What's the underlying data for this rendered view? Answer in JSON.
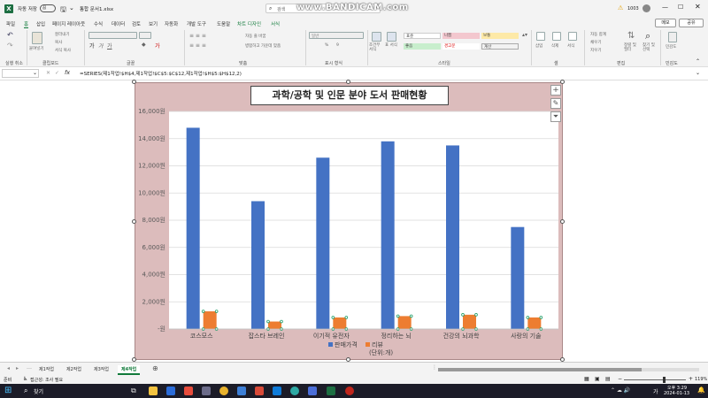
{
  "titlebar": {
    "autosave_label": "자동 저장",
    "autosave_state": "끔",
    "filename": "통합 문서1.xlsx",
    "search_label": "검색",
    "watermark": "www.BANDICAM.com",
    "user_code": "1003",
    "warning_icon": "warning-icon"
  },
  "tabs": [
    "파일",
    "홈",
    "삽입",
    "페이지 레이아웃",
    "수식",
    "데이터",
    "검토",
    "보기",
    "자동화",
    "개발 도구",
    "도움말",
    "차트 디자인",
    "서식"
  ],
  "active_tab": "홈",
  "tab_actions": {
    "memo": "메모",
    "share": "공유"
  },
  "ribbon": {
    "groups": [
      "실행 취소",
      "클립보드",
      "글꼴",
      "맞춤",
      "표시 형식",
      "스타일",
      "셀",
      "편집",
      "민감도"
    ],
    "clipboard": {
      "paste": "붙여넣기",
      "cut": "잘라내기",
      "copy": "복사",
      "format_painter": "서식 복사"
    },
    "alignment": {
      "wrap": "자동 줄 바꿈",
      "merge": "병합하고 가운데 맞춤"
    },
    "number": {
      "format": "일반",
      "percent": "%",
      "comma": "9"
    },
    "styles": {
      "conditional": "조건부 서식",
      "table": "표 서식",
      "cells": [
        "표준",
        "나쁨",
        "보통",
        "좋음",
        "경고문",
        "계산"
      ]
    },
    "cells": [
      "삽입",
      "삭제",
      "서식"
    ],
    "editing": {
      "autosum": "자동 합계",
      "fill": "채우기",
      "clear": "지우기",
      "sort": "정렬 및 필터",
      "find": "찾기 및 선택"
    },
    "sensitivity": "민감도"
  },
  "formula": {
    "name_box": "",
    "fx": "fx",
    "text": "=SERIES(제1작업!$H$4,제1작업!$C$5:$C$12,제1작업!$H$5:$H$12,2)"
  },
  "chart_data": {
    "type": "bar",
    "title": "과학/공학 및 인문 분야 도서 판매현황",
    "categories": [
      "코스모스",
      "잡스타 브레인",
      "이기적 유전자",
      "정리하는 뇌",
      "건강의 뇌과학",
      "사랑의 기술"
    ],
    "series": [
      {
        "name": "판매가격",
        "color": "#4472c4",
        "values": [
          14800,
          9400,
          12600,
          13800,
          13500,
          7500
        ]
      },
      {
        "name": "리뷰(단위:개)",
        "color": "#ed7d31",
        "values": [
          1300,
          550,
          850,
          950,
          1050,
          850
        ]
      }
    ],
    "ylim": [
      0,
      16000
    ],
    "yticks": [
      "-원",
      "2,000원",
      "4,000원",
      "6,000원",
      "8,000원",
      "10,000원",
      "12,000원",
      "14,000원",
      "16,000원"
    ],
    "grid": true,
    "legend_position": "bottom",
    "legend_labels": [
      "판매가격",
      "리뷰"
    ],
    "legend_sub": "(단위:개)"
  },
  "sheet_tabs": [
    "제1작업",
    "제2작업",
    "제3작업",
    "제4작업"
  ],
  "active_sheet": "제4작업",
  "status": {
    "ready": "준비",
    "accessibility": "접근성: 조사 필요",
    "zoom": "119%"
  },
  "taskbar": {
    "search": "찾기",
    "time": "오후 3:29",
    "date": "2024-01-13",
    "lang": "가"
  }
}
